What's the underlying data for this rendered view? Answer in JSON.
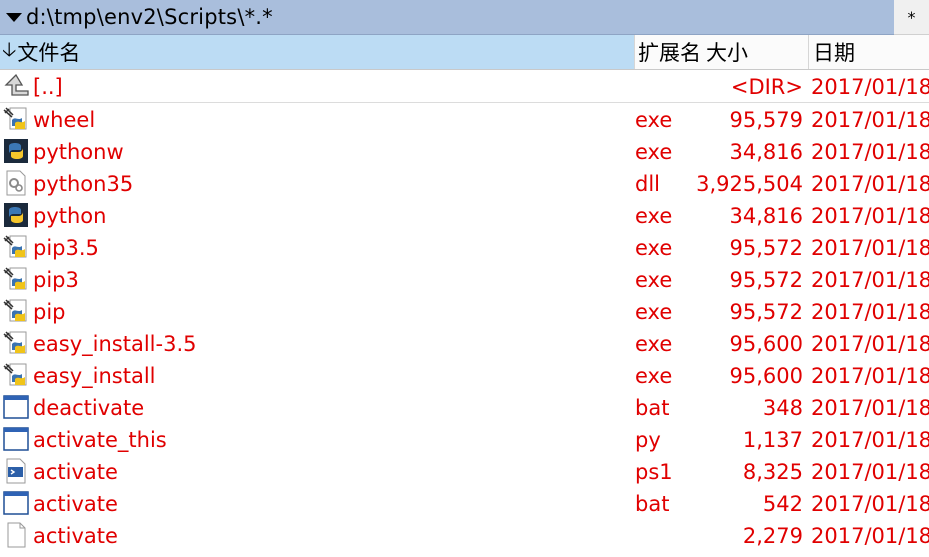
{
  "path_bar": {
    "path": "d:\\tmp\\env2\\Scripts\\*.*",
    "star": "*"
  },
  "columns": {
    "name": "文件名",
    "ext": "扩展名",
    "size": "大小",
    "date": "日期"
  },
  "rows": [
    {
      "name": "[..]",
      "ext": "",
      "size": "<DIR>",
      "date": "2017/01/18",
      "icon": "up-folder-icon"
    },
    {
      "name": "wheel",
      "ext": "exe",
      "size": "95,579",
      "date": "2017/01/18",
      "icon": "python-script-exe-icon"
    },
    {
      "name": "pythonw",
      "ext": "exe",
      "size": "34,816",
      "date": "2017/01/18",
      "icon": "python-app-icon"
    },
    {
      "name": "python35",
      "ext": "dll",
      "size": "3,925,504",
      "date": "2017/01/18",
      "icon": "dll-gear-icon"
    },
    {
      "name": "python",
      "ext": "exe",
      "size": "34,816",
      "date": "2017/01/18",
      "icon": "python-app-icon"
    },
    {
      "name": "pip3.5",
      "ext": "exe",
      "size": "95,572",
      "date": "2017/01/18",
      "icon": "python-script-exe-icon"
    },
    {
      "name": "pip3",
      "ext": "exe",
      "size": "95,572",
      "date": "2017/01/18",
      "icon": "python-script-exe-icon"
    },
    {
      "name": "pip",
      "ext": "exe",
      "size": "95,572",
      "date": "2017/01/18",
      "icon": "python-script-exe-icon"
    },
    {
      "name": "easy_install-3.5",
      "ext": "exe",
      "size": "95,600",
      "date": "2017/01/18",
      "icon": "python-script-exe-icon"
    },
    {
      "name": "easy_install",
      "ext": "exe",
      "size": "95,600",
      "date": "2017/01/18",
      "icon": "python-script-exe-icon"
    },
    {
      "name": "deactivate",
      "ext": "bat",
      "size": "348",
      "date": "2017/01/18",
      "icon": "batch-window-icon"
    },
    {
      "name": "activate_this",
      "ext": "py",
      "size": "1,137",
      "date": "2017/01/18",
      "icon": "batch-window-icon"
    },
    {
      "name": "activate",
      "ext": "ps1",
      "size": "8,325",
      "date": "2017/01/18",
      "icon": "powershell-script-icon"
    },
    {
      "name": "activate",
      "ext": "bat",
      "size": "542",
      "date": "2017/01/18",
      "icon": "batch-window-icon"
    },
    {
      "name": "activate",
      "ext": "",
      "size": "2,279",
      "date": "2017/01/18",
      "icon": "blank-file-icon"
    }
  ],
  "colors": {
    "file_text": "#e00000",
    "path_bar_bg": "#a9bedc",
    "name_header_bg": "#bcdcf4"
  }
}
